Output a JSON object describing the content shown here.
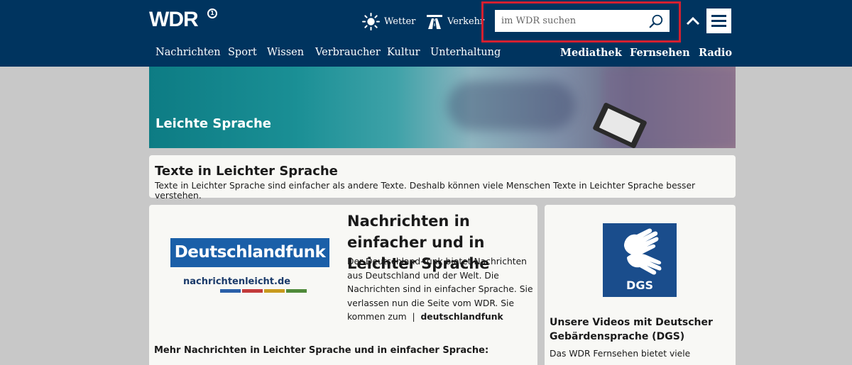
{
  "header": {
    "logo": "WDR",
    "logo_badge": "1",
    "weather_label": "Wetter",
    "traffic_label": "Verkehr",
    "search_placeholder": "im WDR suchen",
    "nav": [
      "Nachrichten",
      "Sport",
      "Wissen",
      "Verbraucher",
      "Kultur",
      "Unterhaltung"
    ],
    "nav_right": [
      "Mediathek",
      "Fernsehen",
      "Radio"
    ]
  },
  "hero": {
    "title": "Leichte Sprache"
  },
  "intro": {
    "title": "Texte in Leichter Sprache",
    "text": "Texte in Leichter Sprache sind einfacher als andere Texte. Deshalb können viele Menschen Texte in Leichter Sprache besser verstehen."
  },
  "news_card": {
    "logo_text": "Deutschlandfunk",
    "logo_url": "nachrichtenleicht.de",
    "title": "Nachrichten in einfacher und in Leichter Sprache",
    "text": "Der Deutschland-funk bietet Nachrichten aus Deutschland und der Welt. Die Nachrichten sind in einfacher Sprache. Sie verlassen nun die Seite vom WDR. Sie kommen zum",
    "separator": "|",
    "link": "deutschlandfunk",
    "more_heading": "Mehr Nachrichten in Leichter Sprache und in einfacher Sprache:"
  },
  "dgs_card": {
    "logo_text": "DGS",
    "title": "Unsere Videos mit Deutscher Gebärdensprache (DGS)",
    "text": "Das WDR Fernsehen bietet viele"
  },
  "colors": {
    "header_bg": "#00345f",
    "highlight": "#d42030",
    "dlf_blue": "#1a5fa8",
    "dgs_blue": "#1a4d8c",
    "bars": [
      "#2a5fa8",
      "#c23b3b",
      "#c89a1e",
      "#4f8a3a"
    ]
  }
}
